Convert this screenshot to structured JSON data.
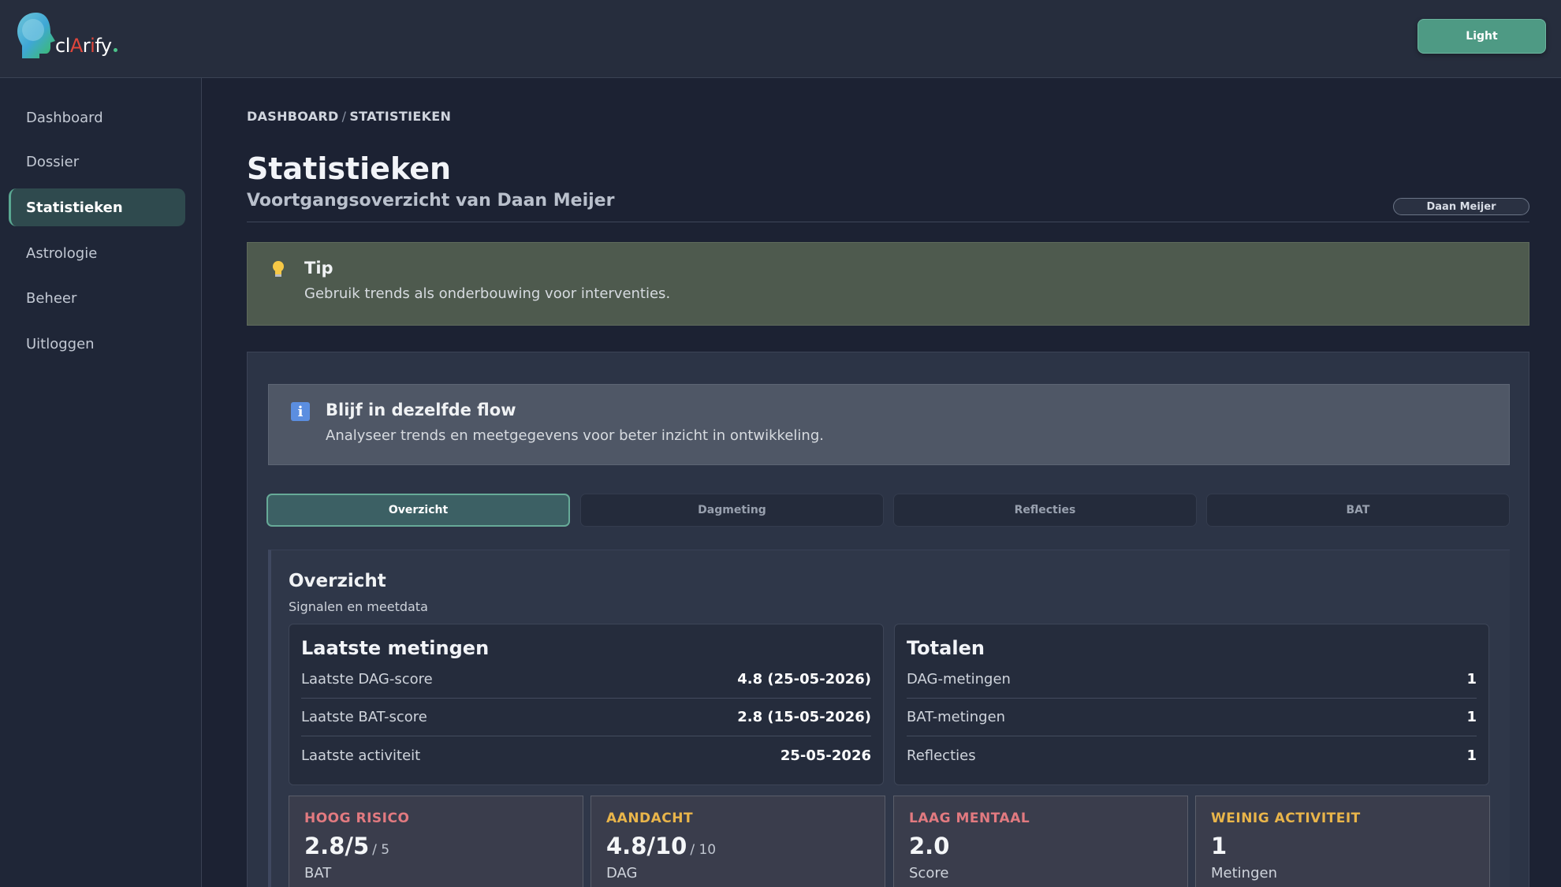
{
  "app": {
    "logo_text": "clArify",
    "theme_button": "Light"
  },
  "sidebar": {
    "items": [
      {
        "label": "Dashboard",
        "active": false
      },
      {
        "label": "Dossier",
        "active": false
      },
      {
        "label": "Statistieken",
        "active": true
      },
      {
        "label": "Astrologie",
        "active": false
      },
      {
        "label": "Beheer",
        "active": false
      },
      {
        "label": "Uitloggen",
        "active": false
      }
    ]
  },
  "breadcrumb": {
    "root": "DASHBOARD",
    "separator": "/",
    "current": "STATISTIEKEN"
  },
  "page": {
    "title": "Statistieken",
    "subtitle": "Voortgangsoverzicht van Daan Meijer",
    "user_pill": "Daan Meijer"
  },
  "tip": {
    "icon": "lightbulb-icon",
    "title": "Tip",
    "text": "Gebruik trends als onderbouwing voor interventies."
  },
  "info": {
    "icon": "info-icon",
    "title": "Blijf in dezelfde flow",
    "text": "Analyseer trends en meetgegevens voor beter inzicht in ontwikkeling."
  },
  "tabs": [
    {
      "label": "Overzicht",
      "active": true
    },
    {
      "label": "Dagmeting",
      "active": false
    },
    {
      "label": "Reflecties",
      "active": false
    },
    {
      "label": "BAT",
      "active": false
    }
  ],
  "overview": {
    "title": "Overzicht",
    "subtitle": "Signalen en meetdata",
    "latest": {
      "title": "Laatste metingen",
      "rows": [
        {
          "label": "Laatste DAG-score",
          "value": "4.8 (25-05-2026)"
        },
        {
          "label": "Laatste BAT-score",
          "value": "2.8 (15-05-2026)"
        },
        {
          "label": "Laatste activiteit",
          "value": "25-05-2026"
        }
      ]
    },
    "totals": {
      "title": "Totalen",
      "rows": [
        {
          "label": "DAG-metingen",
          "value": "1"
        },
        {
          "label": "BAT-metingen",
          "value": "1"
        },
        {
          "label": "Reflecties",
          "value": "1"
        }
      ]
    },
    "signals": [
      {
        "label": "HOOG RISICO",
        "value": "2.8/5",
        "max": "/ 5",
        "unit": "BAT",
        "color": "#e27a80"
      },
      {
        "label": "AANDACHT",
        "value": "4.8/10",
        "max": "/ 10",
        "unit": "DAG",
        "color": "#e9b54a"
      },
      {
        "label": "LAAG MENTAAL",
        "value": "2.0",
        "max": "",
        "unit": "Score",
        "color": "#e27a80"
      },
      {
        "label": "WEINIG ACTIVITEIT",
        "value": "1",
        "max": "",
        "unit": "Metingen",
        "color": "#e9b54a"
      }
    ]
  }
}
